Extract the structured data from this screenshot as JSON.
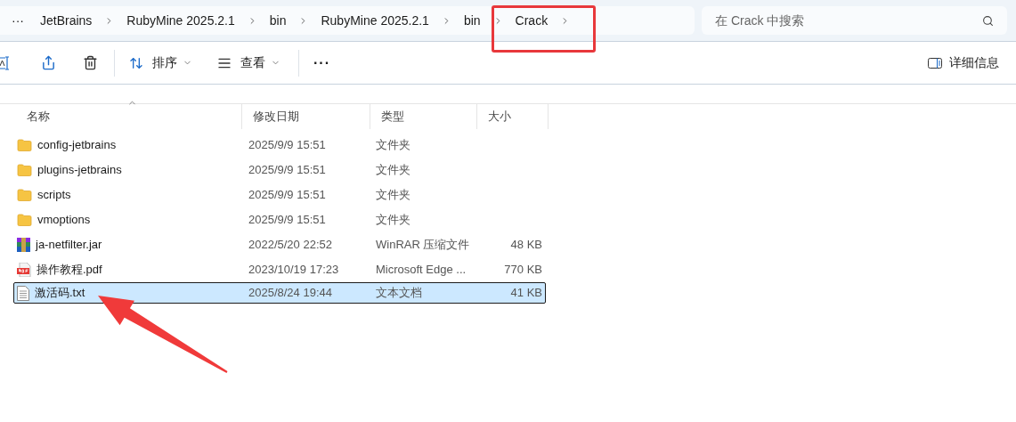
{
  "address_bar": {
    "overflow": "···",
    "crumbs": [
      "JetBrains",
      "RubyMine 2025.2.1",
      "bin",
      "RubyMine 2025.2.1",
      "bin",
      "Crack"
    ]
  },
  "search": {
    "placeholder": "在 Crack 中搜索"
  },
  "toolbar": {
    "menus": [
      "排序",
      "查看"
    ],
    "more": "···",
    "details": "详细信息"
  },
  "table": {
    "columns": [
      "名称",
      "修改日期",
      "类型",
      "大小"
    ],
    "rows": [
      {
        "kind": "folder",
        "name": "config-jetbrains",
        "date": "2025/9/9 15:51",
        "type": "文件夹",
        "selected": false
      },
      {
        "kind": "folder",
        "name": "plugins-jetbrains",
        "date": "2025/9/9 15:51",
        "type": "文件夹",
        "selected": false
      },
      {
        "kind": "folder",
        "name": "scripts",
        "date": "2025/9/9 15:51",
        "type": "文件夹",
        "selected": false
      },
      {
        "kind": "folder",
        "name": "vmoptions",
        "date": "2025/9/9 15:51",
        "type": "文件夹",
        "selected": false
      },
      {
        "kind": "archive",
        "name": "ja-netfilter.jar",
        "date": "2022/5/20 22:52",
        "type": "WinRAR 压缩文件",
        "size": "48 KB",
        "selected": false
      },
      {
        "kind": "pdf",
        "name": "操作教程.pdf",
        "date": "2023/10/19 17:23",
        "type": "Microsoft Edge ...",
        "size": "770 KB",
        "selected": false
      },
      {
        "kind": "text",
        "name": "激活码.txt",
        "date": "2025/8/24 19:44",
        "type": "文本文档",
        "size": "41 KB",
        "selected": true
      }
    ]
  },
  "annotations": [
    {
      "kind": "box"
    },
    {
      "kind": "arrow"
    }
  ]
}
